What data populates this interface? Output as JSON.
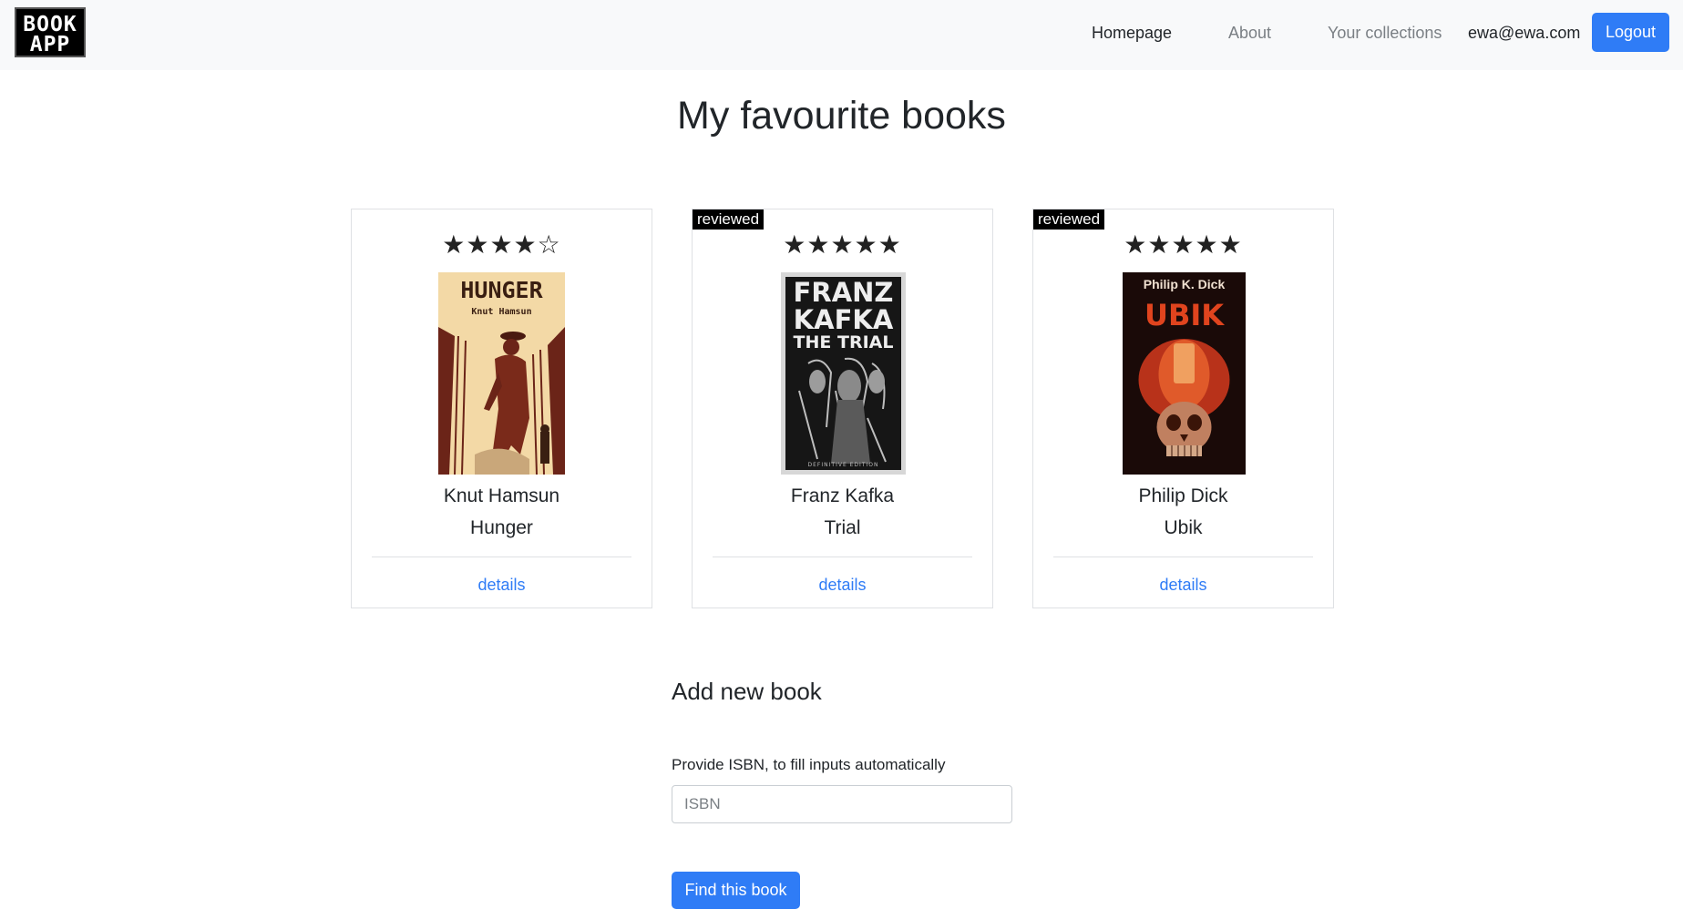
{
  "app": {
    "logo_line1": "BOOK",
    "logo_line2": "APP"
  },
  "nav": {
    "links": [
      {
        "label": "Homepage",
        "active": true
      },
      {
        "label": "About",
        "active": false
      },
      {
        "label": "Your collections",
        "active": false
      }
    ],
    "user_email": "ewa@ewa.com",
    "logout_label": "Logout"
  },
  "page": {
    "title": "My favourite books"
  },
  "books": [
    {
      "rating": 4,
      "max_rating": 5,
      "stars": "★★★★☆",
      "reviewed": false,
      "badge": "",
      "author": "Knut Hamsun",
      "title": "Hunger",
      "details_label": "details",
      "cover_text": {
        "title": "HUNGER",
        "author": "Knut Hamsun"
      }
    },
    {
      "rating": 5,
      "max_rating": 5,
      "stars": "★★★★★",
      "reviewed": true,
      "badge": "reviewed",
      "author": "Franz Kafka",
      "title": "Trial",
      "details_label": "details",
      "cover_text": {
        "line1": "FRANZ",
        "line2": "KAFKA",
        "line3": "THE TRIAL",
        "footer": "DEFINITIVE EDITION"
      }
    },
    {
      "rating": 5,
      "max_rating": 5,
      "stars": "★★★★★",
      "reviewed": true,
      "badge": "reviewed",
      "author": "Philip Dick",
      "title": "Ubik",
      "details_label": "details",
      "cover_text": {
        "author": "Philip K. Dick",
        "title": "UBIK"
      }
    }
  ],
  "add_book": {
    "heading": "Add new book",
    "isbn_label": "Provide ISBN, to fill inputs automatically",
    "isbn_placeholder": "ISBN",
    "isbn_value": "",
    "find_label": "Find this book"
  }
}
